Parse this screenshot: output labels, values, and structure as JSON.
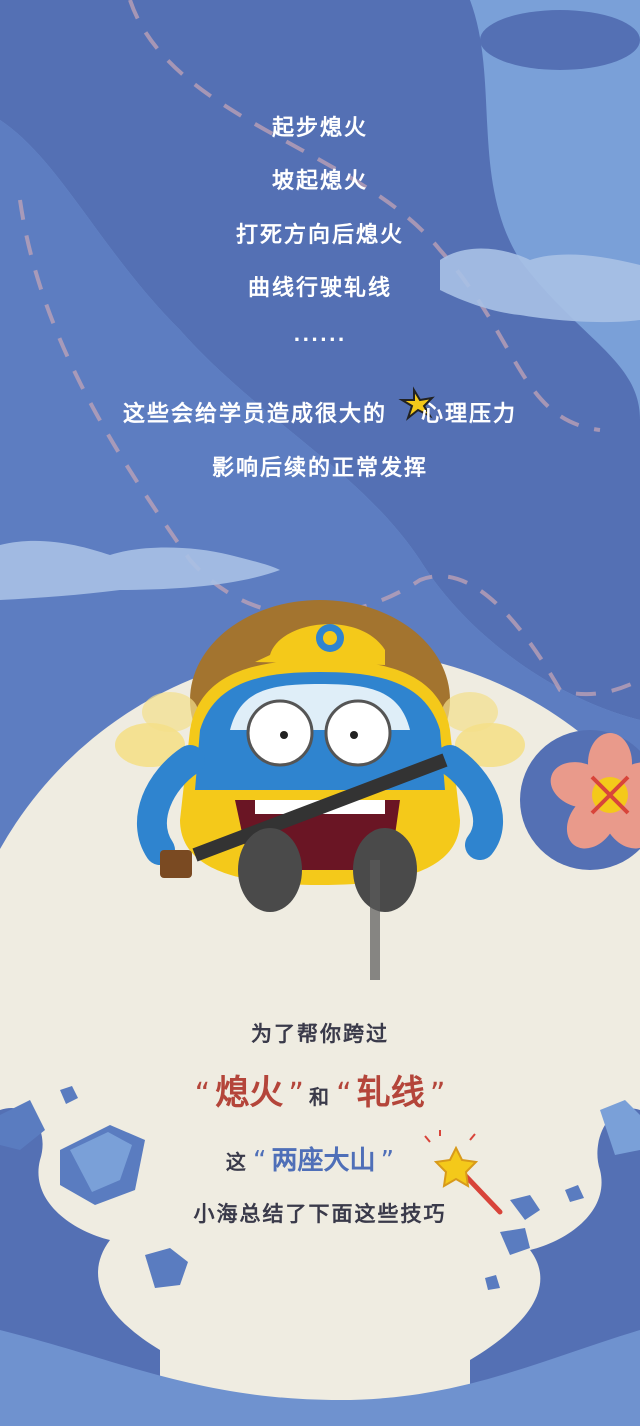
{
  "lines_top": [
    "起步熄火",
    "坡起熄火",
    "打死方向后熄火",
    "曲线行驶轧线",
    "......"
  ],
  "pressure_line": {
    "before": "这些会给学员造成很大的",
    "after": "心理压力"
  },
  "impact_line": "影响后续的正常发挥",
  "bottom": {
    "line1": "为了帮你跨过",
    "word1": "熄火",
    "connector": "和",
    "word2": "轧线",
    "line3_prefix": "这",
    "mountains": "两座大山",
    "line4": "小海总结了下面这些技巧"
  },
  "colors": {
    "bg_blue": "#5d7dc1",
    "light_blue": "#7aa0d8",
    "cream": "#efece1",
    "red_accent": "#b4453a",
    "car_blue": "#2f84cf",
    "car_yellow": "#f4c91a"
  },
  "icons": [
    "anger-sparkle-icon",
    "magic-wand-icon",
    "car-mascot",
    "flower-icon",
    "rock-icon"
  ]
}
